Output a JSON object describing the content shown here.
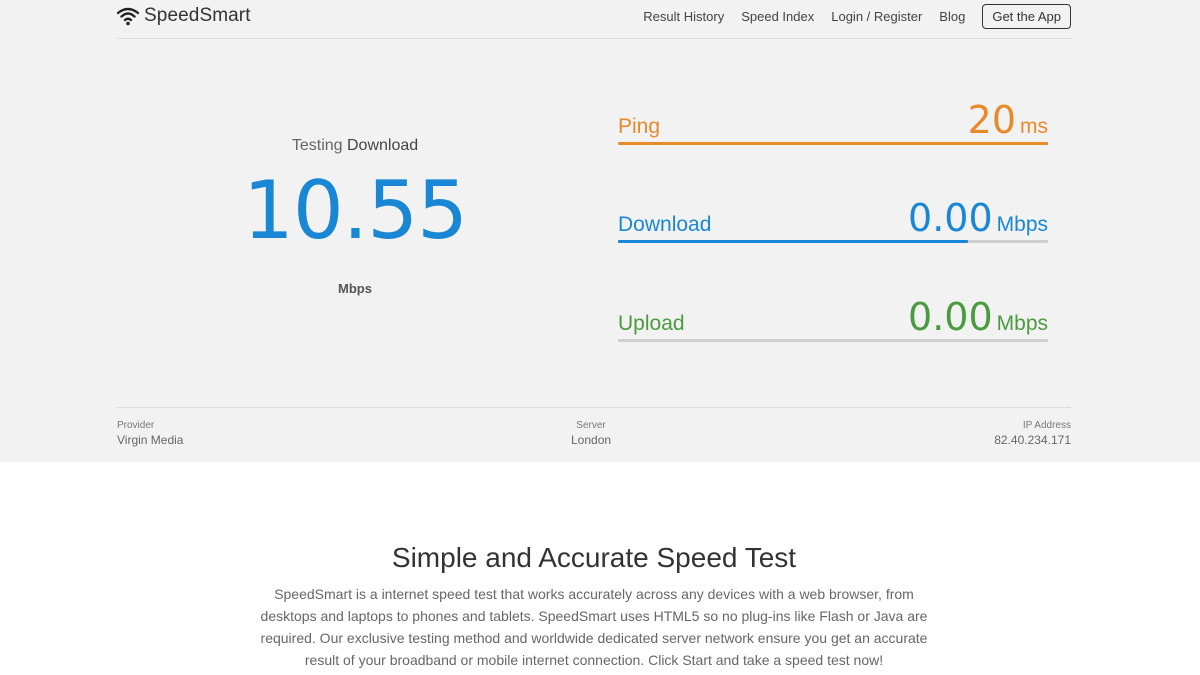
{
  "header": {
    "logo_text": "SpeedSmart",
    "logo_icon": "wifi-icon",
    "nav": {
      "result_history": "Result History",
      "speed_index": "Speed Index",
      "login_register": "Login / Register",
      "blog": "Blog",
      "get_app": "Get the App"
    }
  },
  "gauge": {
    "testing_prefix": "Testing",
    "testing_target": "Download",
    "value": "10.55",
    "unit": "Mbps"
  },
  "metrics": {
    "ping": {
      "label": "Ping",
      "value": "20",
      "unit": "ms",
      "progress": 1.0,
      "color": "#e8892a"
    },
    "download": {
      "label": "Download",
      "value": "0.00",
      "unit": "Mbps",
      "progress": 0.815,
      "color": "#1a87d6"
    },
    "upload": {
      "label": "Upload",
      "value": "0.00",
      "unit": "Mbps",
      "progress": 0.0,
      "color": "#4a9b3f"
    }
  },
  "info": {
    "provider_label": "Provider",
    "provider_value": "Virgin Media",
    "server_label": "Server",
    "server_value": "London",
    "ip_label": "IP Address",
    "ip_value": "82.40.234.171"
  },
  "about": {
    "title": "Simple and Accurate Speed Test",
    "text": "SpeedSmart is a internet speed test that works accurately across any devices with a web browser, from desktops and laptops to phones and tablets. SpeedSmart uses HTML5 so no plug-ins like Flash or Java are required. Our exclusive testing method and worldwide dedicated server network ensure you get an accurate result of your broadband or mobile internet connection. Click Start and take a speed test now!"
  }
}
